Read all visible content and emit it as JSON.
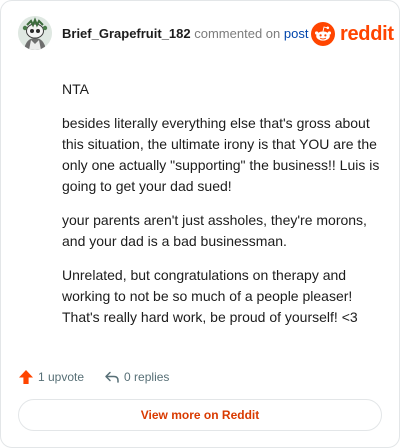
{
  "comment": {
    "author": "Brief_Grapefruit_182",
    "action_text": "commented on",
    "post_link": "post",
    "paragraphs": [
      "NTA",
      "besides literally everything else that's gross about this situation, the ultimate irony is that YOU are the only one actually \"supporting\" the business!! Luis is going to get your dad sued!",
      "your parents aren't just assholes, they're morons, and your dad is a bad businessman.",
      "Unrelated, but congratulations on therapy and working to not be so much of a people pleaser! That's really hard work, be proud of yourself! <3"
    ]
  },
  "brand": {
    "name": "reddit",
    "color": "#ff4500"
  },
  "actions": {
    "upvote_label": "1 upvote",
    "reply_label": "0 replies"
  },
  "footer": {
    "view_more_label": "View more on Reddit"
  },
  "icons": {
    "avatar": "snoo-avatar",
    "logo": "reddit-snoo-icon",
    "upvote": "upvote-arrow-icon",
    "reply": "reply-arrow-icon"
  },
  "colors": {
    "link": "#0045ac",
    "upvote": "#ff4500",
    "view_more_text": "#d93a00",
    "muted": "#576f76"
  }
}
